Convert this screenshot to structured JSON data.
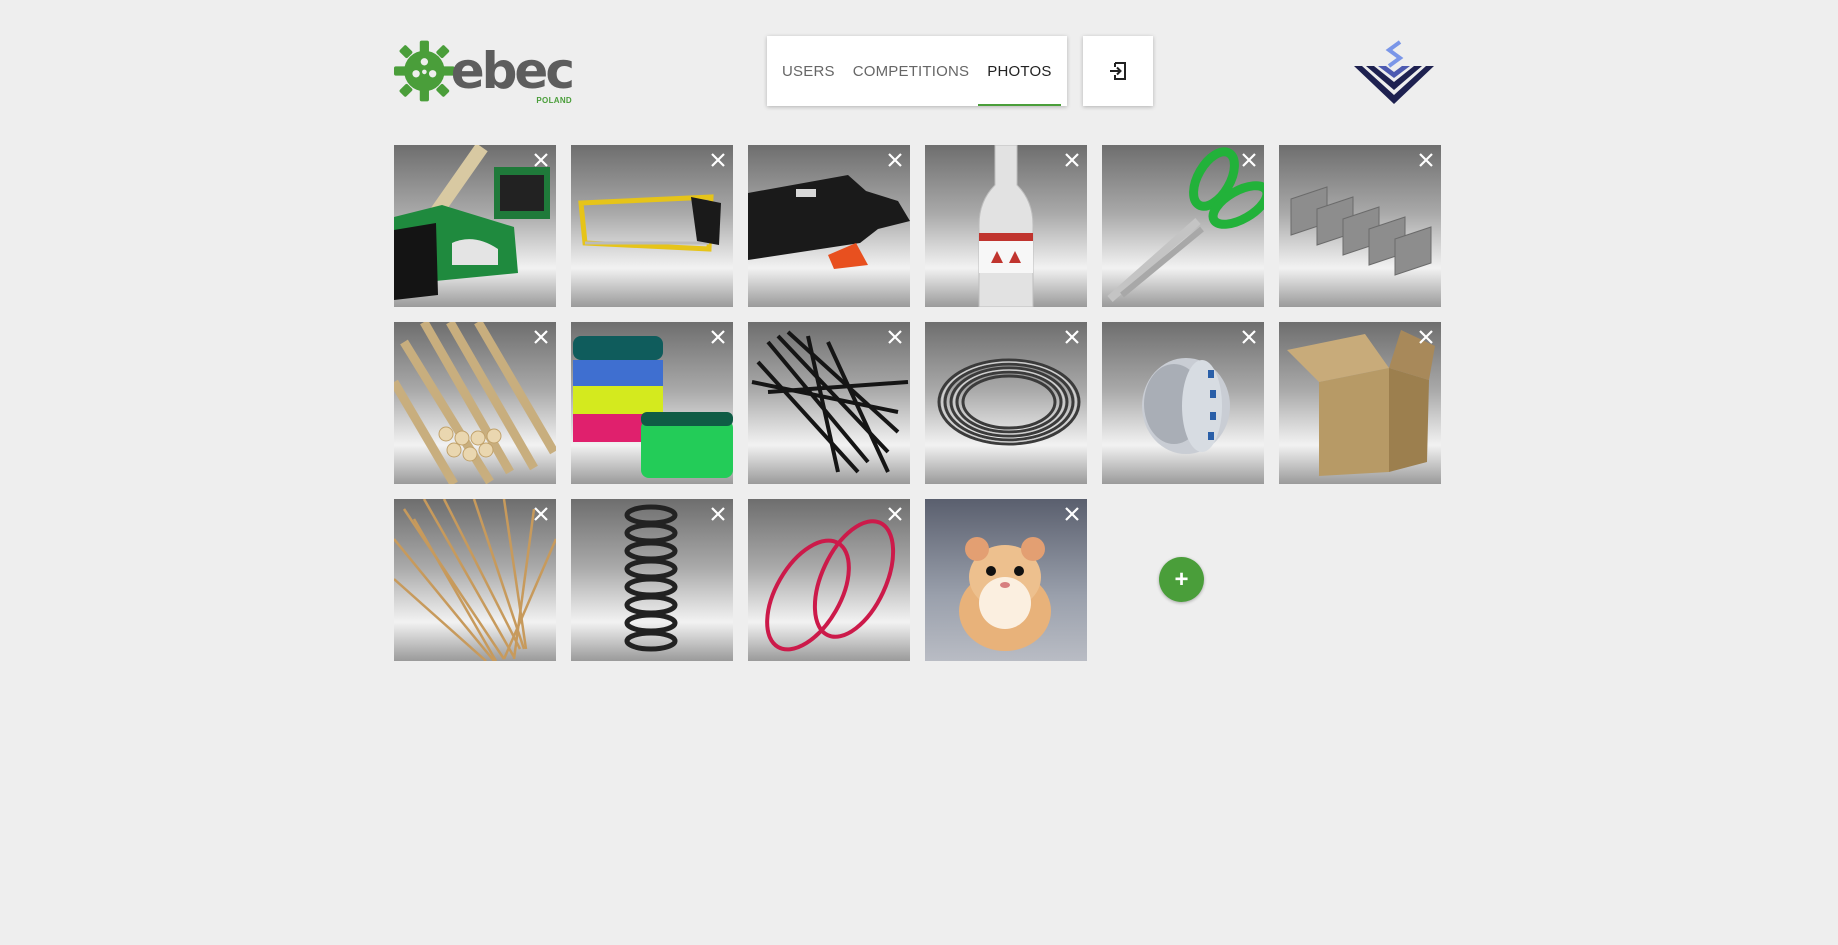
{
  "header": {
    "logo_text": "ebec",
    "logo_subtext": "POLAND",
    "nav": [
      {
        "label": "USERS",
        "active": false
      },
      {
        "label": "COMPETITIONS",
        "active": false
      },
      {
        "label": "PHOTOS",
        "active": true
      }
    ],
    "logout_icon": "logout-icon",
    "brand_icon": "partner-logo-icon"
  },
  "gallery": {
    "photos": [
      {
        "subject": "stapler",
        "icon": "stapler-icon"
      },
      {
        "subject": "hacksaw",
        "icon": "hacksaw-icon"
      },
      {
        "subject": "glue gun",
        "icon": "glue-gun-icon"
      },
      {
        "subject": "solvent bottle",
        "icon": "bottle-icon"
      },
      {
        "subject": "scissors",
        "icon": "scissors-icon"
      },
      {
        "subject": "staples",
        "icon": "staples-icon"
      },
      {
        "subject": "wooden dowels",
        "icon": "dowels-icon"
      },
      {
        "subject": "sponges",
        "icon": "sponges-icon"
      },
      {
        "subject": "cable ties",
        "icon": "cable-ties-icon"
      },
      {
        "subject": "wire coil",
        "icon": "wire-coil-icon"
      },
      {
        "subject": "tape roll",
        "icon": "tape-icon"
      },
      {
        "subject": "cardboard box",
        "icon": "box-icon"
      },
      {
        "subject": "skewers",
        "icon": "skewers-icon"
      },
      {
        "subject": "spring",
        "icon": "spring-icon"
      },
      {
        "subject": "rubber bands",
        "icon": "rubber-bands-icon"
      },
      {
        "subject": "hamster",
        "icon": "hamster-icon"
      }
    ],
    "delete_icon": "close-icon",
    "add_label": "+"
  },
  "colors": {
    "brand_green": "#4a9e3a",
    "background": "#eeeeee",
    "navy": "#1e2150",
    "light_blue": "#7a96e8"
  }
}
